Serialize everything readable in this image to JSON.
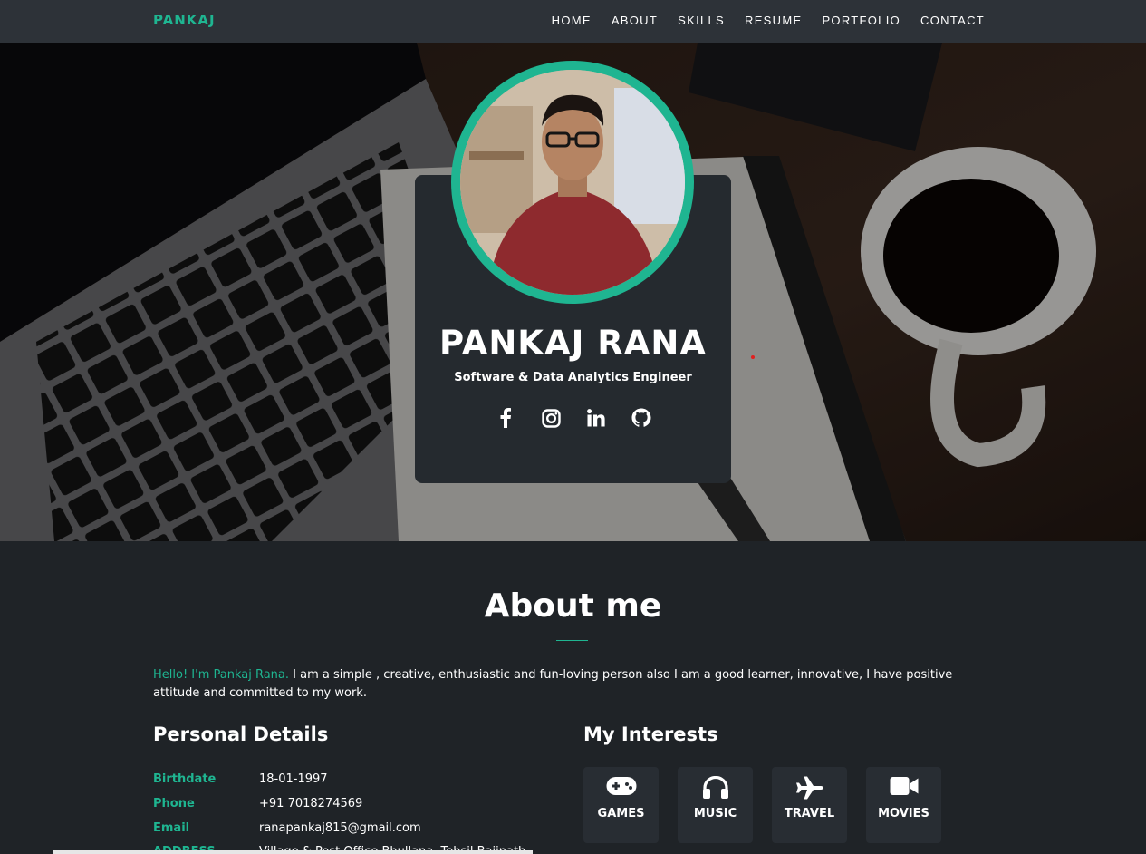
{
  "nav": {
    "brand": "PANKAJ",
    "links": [
      "HOME",
      "ABOUT",
      "SKILLS",
      "RESUME",
      "PORTFOLIO",
      "CONTACT"
    ]
  },
  "hero": {
    "name": "PANKAJ RANA",
    "role": "Software & Data Analytics Engineer",
    "socials": [
      "facebook-icon",
      "instagram-icon",
      "linkedin-icon",
      "github-icon"
    ]
  },
  "about": {
    "title": "About me",
    "hello": "Hello! I'm Pankaj Rana.",
    "intro": " I am a simple , creative, enthusiastic and fun-loving person also I am a good learner, innovative, I have positive attitude and committed to my work."
  },
  "personal": {
    "title": "Personal Details",
    "rows": [
      {
        "label": "Birthdate",
        "value": "18-01-1997"
      },
      {
        "label": "Phone",
        "value": "+91 7018274569"
      },
      {
        "label": "Email",
        "value": "ranapankaj815@gmail.com"
      },
      {
        "label": "ADDRESS",
        "value": "Village & Post Office Bhullana, Tehsil Baijnath"
      }
    ]
  },
  "interests": {
    "title": "My Interests",
    "items": [
      {
        "label": "GAMES",
        "icon": "gamepad-icon"
      },
      {
        "label": "MUSIC",
        "icon": "headphones-icon"
      },
      {
        "label": "TRAVEL",
        "icon": "plane-icon"
      },
      {
        "label": "MOVIES",
        "icon": "video-camera-icon"
      }
    ]
  },
  "colors": {
    "accent": "#1fb591",
    "navbar": "#2d3238",
    "background": "#1f2327",
    "card": "#252a2f"
  }
}
